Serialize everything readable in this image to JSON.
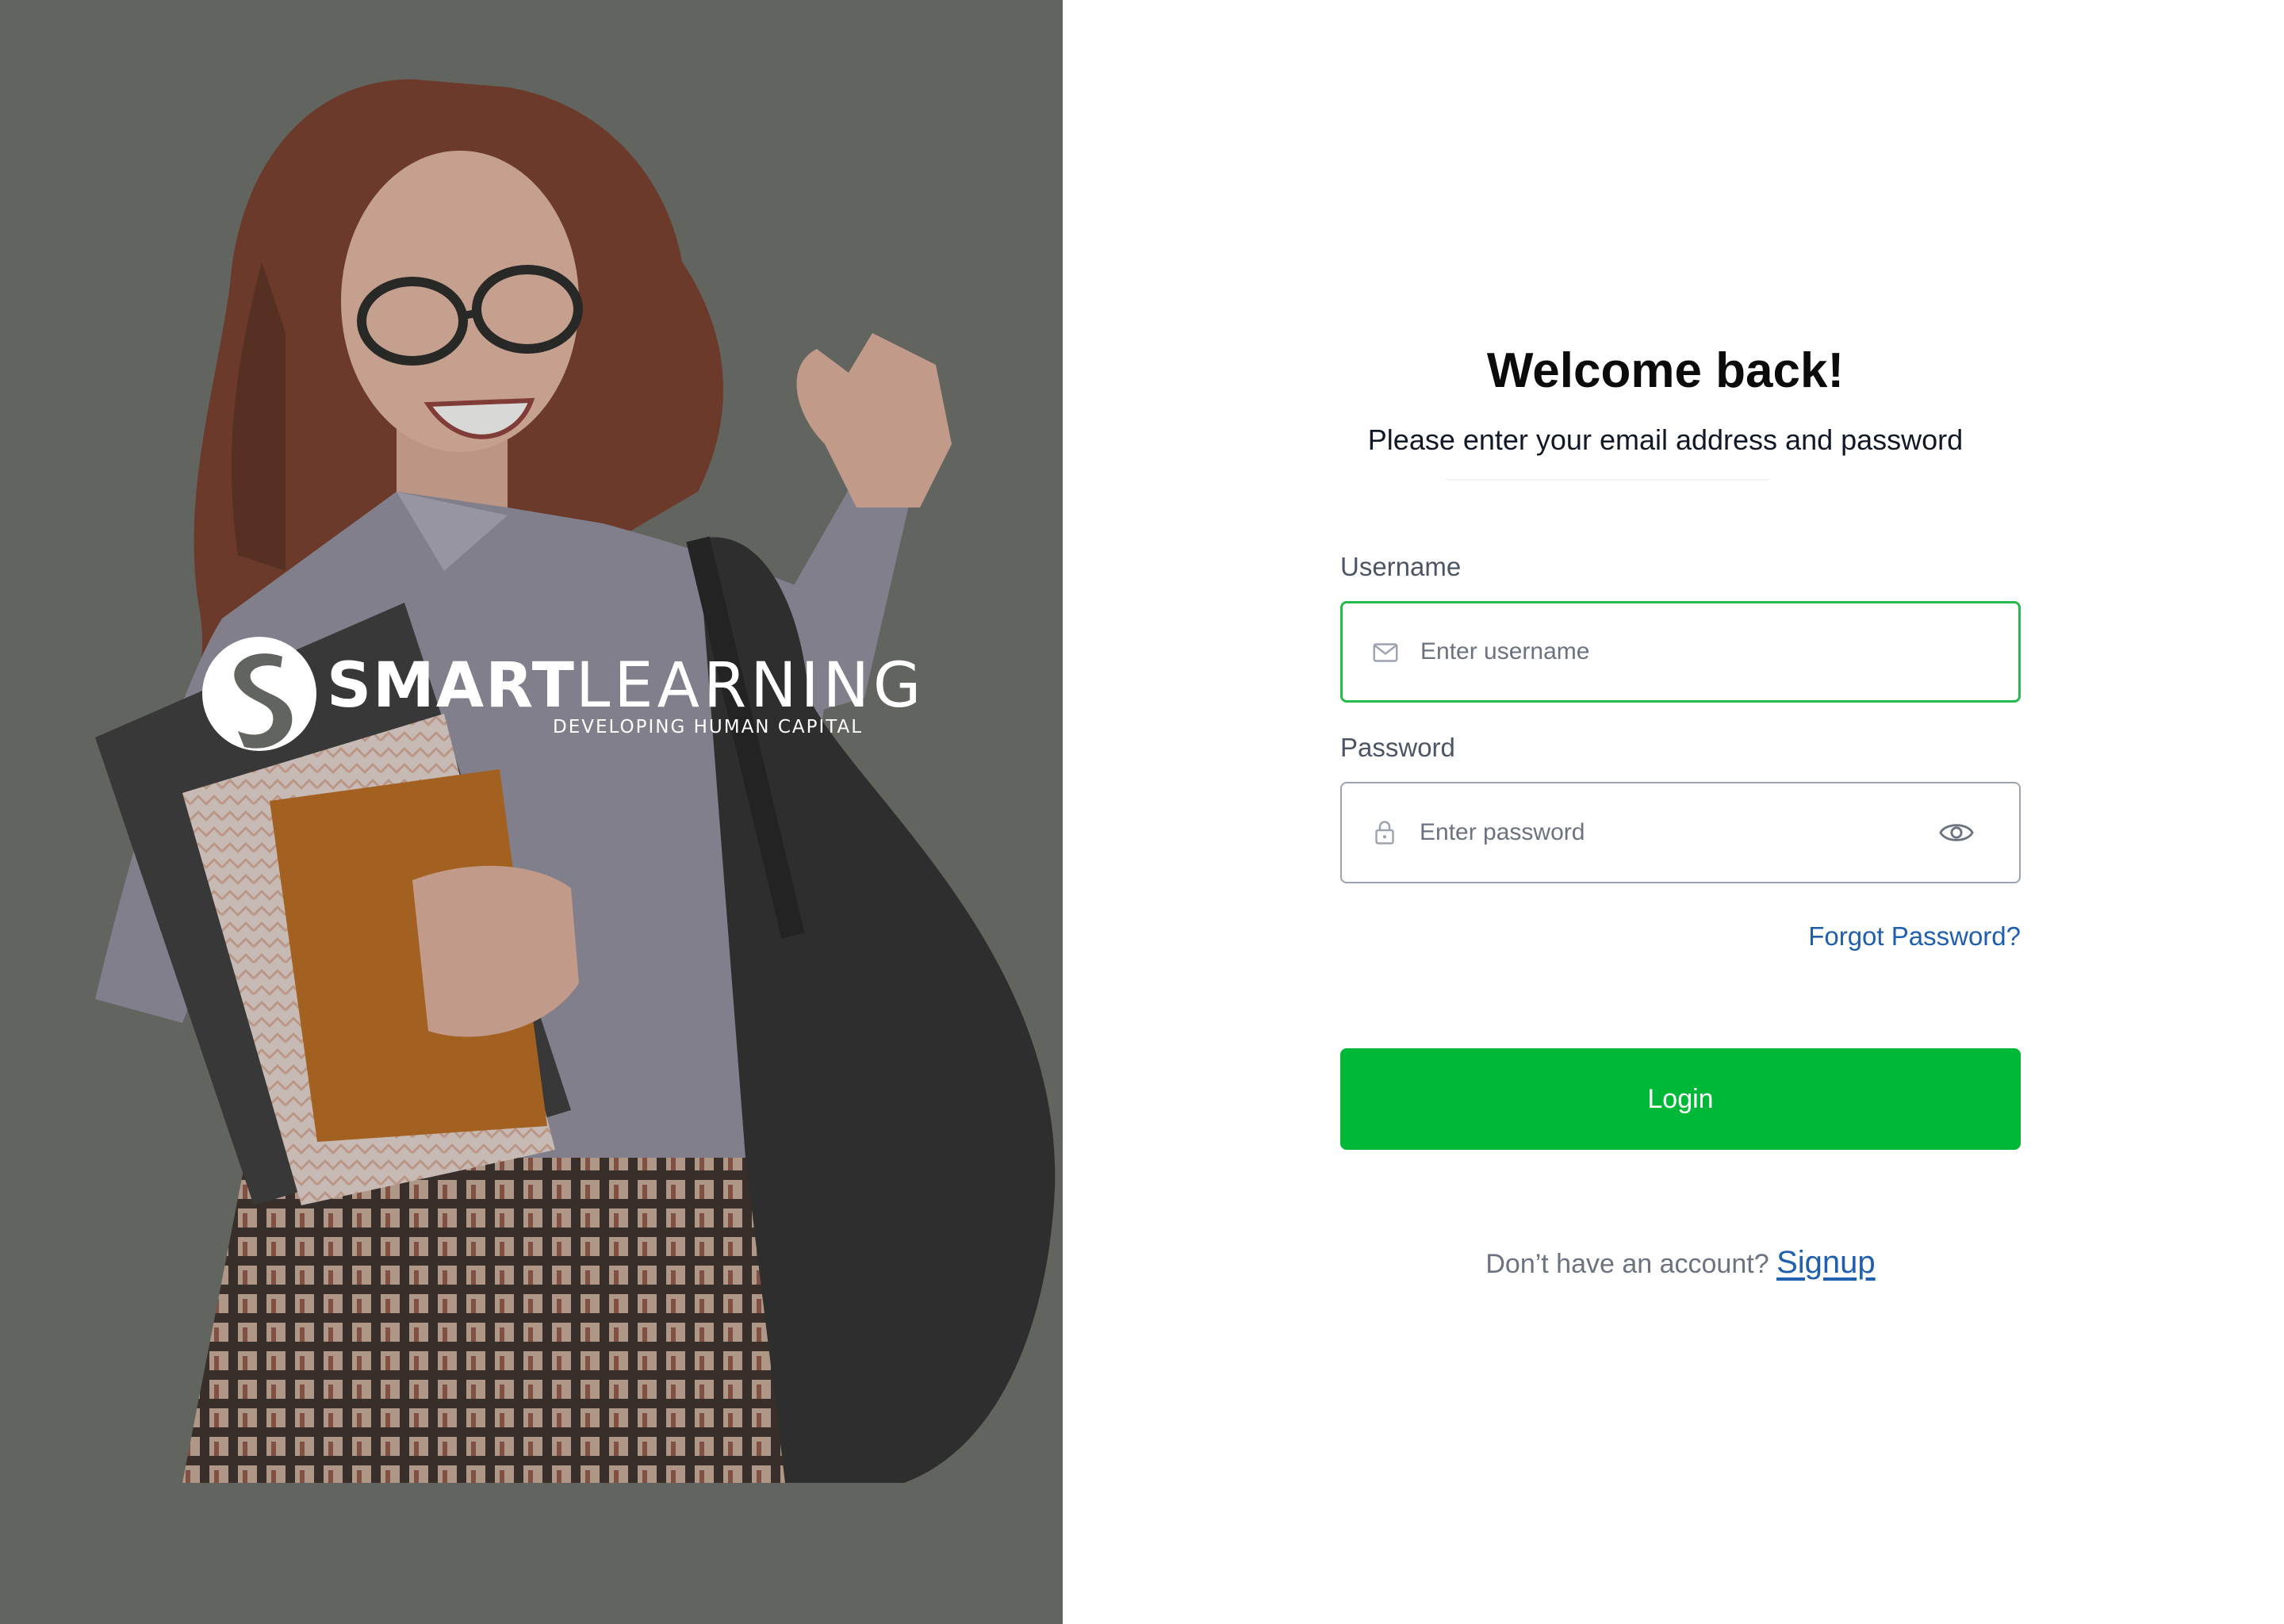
{
  "hero": {
    "brand_name_bold": "SMART",
    "brand_name_light": "LEARNING",
    "brand_tagline": "DEVELOPING HUMAN CAPITAL",
    "background_color": "#62645f"
  },
  "login": {
    "title": "Welcome back!",
    "subtitle": "Please enter your email address and password",
    "username": {
      "label": "Username",
      "placeholder": "Enter username",
      "value": "",
      "icon": "mail-icon"
    },
    "password": {
      "label": "Password",
      "placeholder": "Enter password",
      "value": "",
      "icon": "lock-icon",
      "toggle_icon": "eye-icon"
    },
    "forgot_password": "Forgot Password?",
    "login_button": "Login",
    "signup_prompt": "Don’t have an account?",
    "signup_link": "Signup"
  },
  "colors": {
    "primary_green": "#00b838",
    "focus_border": "#26b94d",
    "link_blue": "#1f5fae"
  }
}
